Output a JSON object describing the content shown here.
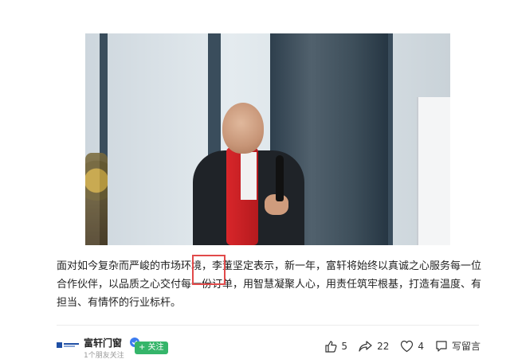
{
  "article": {
    "paragraph": "面对如今复杂而严峻的市场环境，李董坚定表示，新一年，富轩将始终以真诚之心服务每一位合作伙伴，以品质之心交付每一份订单，用智慧凝聚人心，用责任筑牢根基，打造有温度、有担当、有情怀的行业标杆。"
  },
  "author": {
    "name": "富轩门窗",
    "followers": "1个朋友关注",
    "follow_label": "+ 关注"
  },
  "actions": {
    "likes": "5",
    "shares": "22",
    "favorites": "4",
    "comment_label": "写留言"
  },
  "colors": {
    "highlight": "#e14a4a",
    "follow": "#35b56a",
    "verified": "#3d7cf0"
  }
}
